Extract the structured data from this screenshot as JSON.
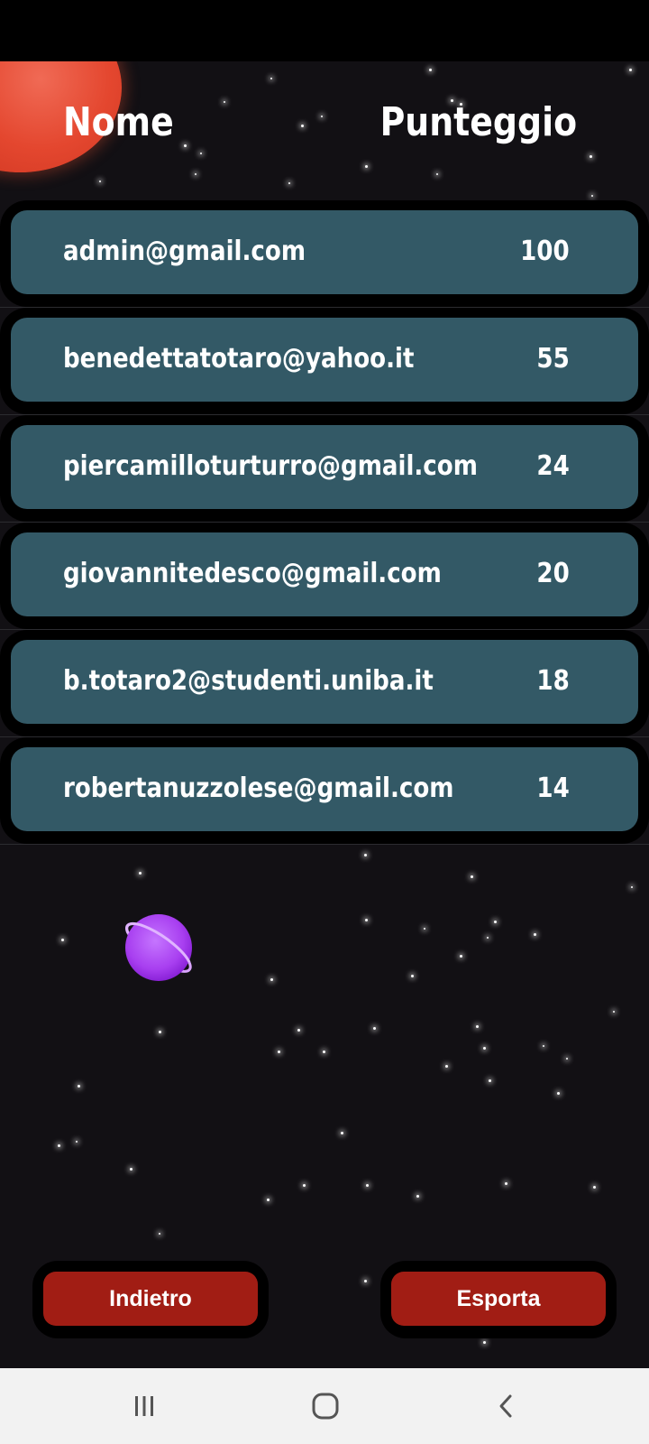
{
  "header": {
    "name_label": "Nome",
    "score_label": "Punteggio"
  },
  "leaderboard": [
    {
      "email": "admin@gmail.com",
      "score": "100"
    },
    {
      "email": "benedettatotaro@yahoo.it",
      "score": "55"
    },
    {
      "email": "piercamilloturturro@gmail.com",
      "score": "24"
    },
    {
      "email": "giovannitedesco@gmail.com",
      "score": "20"
    },
    {
      "email": "b.totaro2@studenti.uniba.it",
      "score": "18"
    },
    {
      "email": "robertanuzzolese@gmail.com",
      "score": "14"
    }
  ],
  "buttons": {
    "back_label": "Indietro",
    "export_label": "Esporta"
  },
  "colors": {
    "background": "#121014",
    "row_fill": "#335966",
    "button_fill": "#a11d14",
    "red_planet": "#e4472f",
    "purple_planet": "#a83ff0"
  },
  "icons": {
    "nav_recents": "recents-icon",
    "nav_home": "home-icon",
    "nav_back": "back-arrow-icon",
    "decor_1": "red-planet",
    "decor_2": "purple-ringed-planet"
  }
}
